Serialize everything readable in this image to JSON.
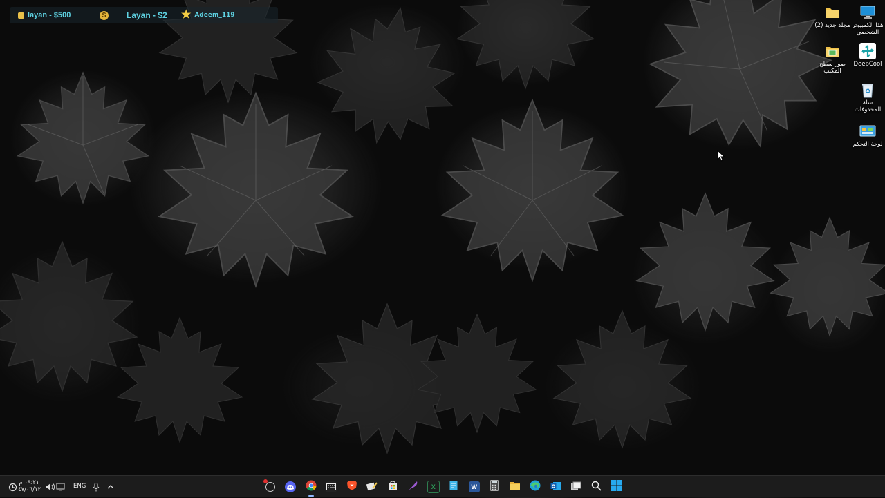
{
  "overlay": {
    "items": [
      {
        "icon": "gold-bar-icon",
        "text": "layan - $500"
      },
      {
        "icon": "dollar-coin-icon",
        "symbol": "$"
      },
      {
        "text": "Layan - $2"
      },
      {
        "icon": "star-icon",
        "text": "Adeem_119"
      }
    ]
  },
  "desktop": {
    "icons": [
      {
        "name": "this-pc",
        "label_lines": [
          "هذا الكمبيوتر",
          "الشخصي"
        ],
        "icon": "monitor-icon"
      },
      {
        "name": "new-folder-2",
        "label_lines": [
          "مجلد جديد (2)"
        ],
        "icon": "folder-icon"
      },
      {
        "name": "deepcool",
        "label_lines": [
          "DeepCool"
        ],
        "icon": "deepcool-icon"
      },
      {
        "name": "desktop-pictures",
        "label_lines": [
          "صور سطح",
          "المكتب"
        ],
        "icon": "picture-folder-icon"
      },
      {
        "name": "recycle-bin",
        "label_lines": [
          "سلة",
          "المحذوفات"
        ],
        "icon": "recycle-bin-icon"
      },
      {
        "name": "control-panel",
        "label_lines": [
          "لوحة التحكم"
        ],
        "icon": "control-panel-icon"
      }
    ]
  },
  "taskbar": {
    "clock": {
      "time": "٠٩:٢١ م",
      "date": "٤٧/٠٦/١٢"
    },
    "language": "ENG",
    "tray_icons": [
      "update-icon",
      "speaker-icon",
      "network-icon",
      "microphone-icon",
      "chevron-up-icon"
    ],
    "apps": [
      {
        "name": "task-app",
        "icon": "clock-badge-icon",
        "badge": true
      },
      {
        "name": "discord",
        "icon": "discord-icon"
      },
      {
        "name": "chrome",
        "icon": "chrome-icon",
        "active": true
      },
      {
        "name": "keyboard-app",
        "icon": "keyboard-icon"
      },
      {
        "name": "brave",
        "icon": "brave-icon"
      },
      {
        "name": "notes-app",
        "icon": "notes-icon"
      },
      {
        "name": "microsoft-store",
        "icon": "store-icon"
      },
      {
        "name": "pen-app",
        "icon": "feather-icon"
      },
      {
        "name": "excel",
        "icon": "excel-icon"
      },
      {
        "name": "notepad",
        "icon": "notepad-icon"
      },
      {
        "name": "word",
        "icon": "word-icon"
      },
      {
        "name": "calculator",
        "icon": "calculator-icon"
      },
      {
        "name": "file-explorer",
        "icon": "folder-icon"
      },
      {
        "name": "edge",
        "icon": "edge-icon"
      },
      {
        "name": "outlook",
        "icon": "outlook-icon"
      },
      {
        "name": "task-view",
        "icon": "task-view-icon"
      },
      {
        "name": "search",
        "icon": "search-icon"
      },
      {
        "name": "start",
        "icon": "windows-logo-icon"
      }
    ]
  },
  "colors": {
    "overlay_text": "#5fd3e3",
    "taskbar_bg": "#1c1c1c",
    "accent": "#8fb8ff"
  }
}
